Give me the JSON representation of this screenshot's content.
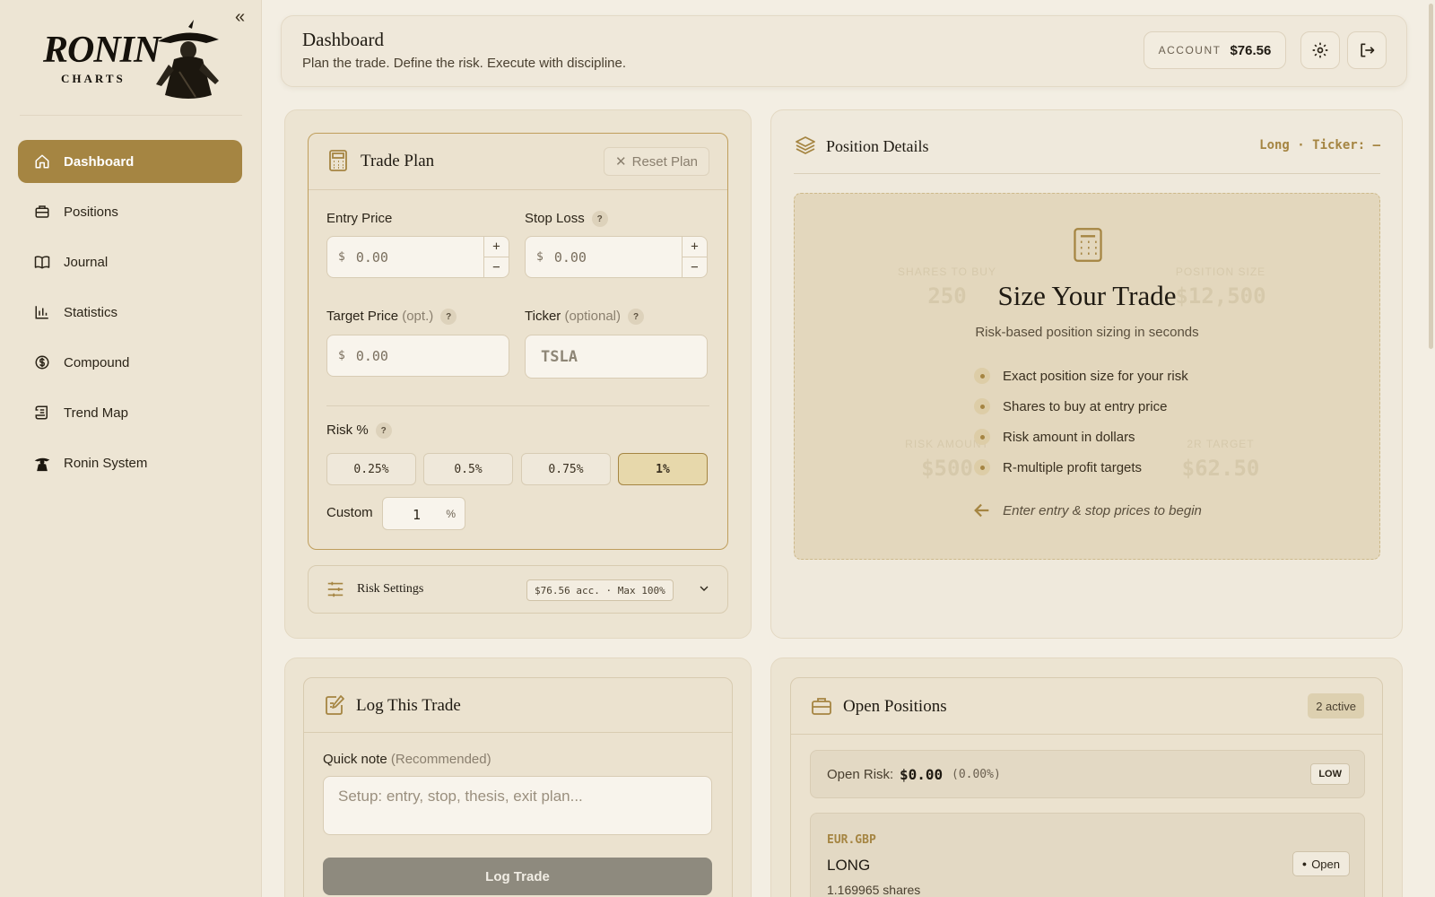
{
  "sidebar": {
    "logo_text": "RONIN",
    "logo_sub": "CHARTS",
    "items": [
      {
        "label": "Dashboard",
        "icon": "home-icon",
        "active": true
      },
      {
        "label": "Positions",
        "icon": "briefcase-icon"
      },
      {
        "label": "Journal",
        "icon": "book-icon"
      },
      {
        "label": "Statistics",
        "icon": "bar-chart-icon"
      },
      {
        "label": "Compound",
        "icon": "dollar-circle-icon"
      },
      {
        "label": "Trend Map",
        "icon": "scroll-icon"
      },
      {
        "label": "Ronin System",
        "icon": "ronin-figure-icon"
      }
    ]
  },
  "header": {
    "title": "Dashboard",
    "subtitle": "Plan the trade. Define the risk. Execute with discipline.",
    "account_label": "ACCOUNT",
    "account_value": "$76.56"
  },
  "trade_plan": {
    "title": "Trade Plan",
    "reset_label": "Reset Plan",
    "entry_label": "Entry Price",
    "entry_currency": "$",
    "entry_value": "0.00",
    "stop_label": "Stop Loss",
    "stop_currency": "$",
    "stop_value": "0.00",
    "target_label": "Target Price",
    "target_opt": "(opt.)",
    "target_currency": "$",
    "target_value": "0.00",
    "ticker_label": "Ticker",
    "ticker_opt": "(optional)",
    "ticker_placeholder": "TSLA",
    "risk_label": "Risk %",
    "risk_options": [
      "0.25%",
      "0.5%",
      "0.75%",
      "1%"
    ],
    "risk_selected": "1%",
    "custom_label": "Custom",
    "custom_value": "1",
    "custom_unit": "%"
  },
  "risk_settings": {
    "title": "Risk Settings",
    "badge": "$76.56 acc. · Max 100%"
  },
  "position_details": {
    "title": "Position Details",
    "meta": "Long · Ticker: —",
    "ghost": [
      {
        "label": "SHARES TO BUY",
        "value": "250"
      },
      {
        "label": "POSITION SIZE",
        "value": "$12,500"
      },
      {
        "label": "RISK AMOUNT",
        "value": "$500"
      },
      {
        "label": "2R TARGET",
        "value": "$62.50"
      }
    ],
    "heading": "Size Your Trade",
    "subheading": "Risk-based position sizing in seconds",
    "bullets": [
      "Exact position size for your risk",
      "Shares to buy at entry price",
      "Risk amount in dollars",
      "R-multiple profit targets"
    ],
    "hint": "Enter entry & stop prices to begin"
  },
  "log_trade": {
    "title": "Log This Trade",
    "note_label": "Quick note",
    "note_opt": "(Recommended)",
    "note_placeholder": "Setup: entry, stop, thesis, exit plan...",
    "button_label": "Log Trade"
  },
  "open_positions": {
    "title": "Open Positions",
    "badge": "2 active",
    "open_risk_label": "Open Risk:",
    "open_risk_value": "$0.00",
    "open_risk_pct": "(0.00%)",
    "risk_level": "LOW",
    "positions": [
      {
        "symbol": "EUR.GBP",
        "side": "LONG",
        "shares": "1.169965 shares",
        "status": "Open"
      }
    ]
  },
  "colors": {
    "accent": "#a58542",
    "background": "#f3eee3",
    "sidebar": "#ede5d4"
  }
}
